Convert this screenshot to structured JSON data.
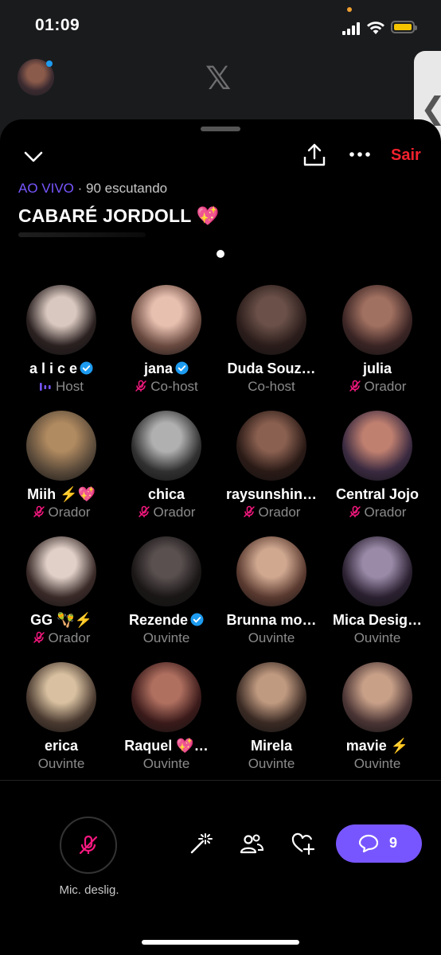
{
  "status_bar": {
    "time": "01:09"
  },
  "background_app": {
    "logo": "𝕏"
  },
  "header": {
    "leave_label": "Sair",
    "live_label": "AO VIVO",
    "listeners": "· 90 escutando",
    "title": "CABARÉ JORDOLL",
    "title_emoji": "💖"
  },
  "participants": [
    {
      "name": "a l i c e",
      "role": "Host",
      "verified": true,
      "mic": "host",
      "avatar_colors": [
        "#d9c8bf",
        "#2a2020"
      ]
    },
    {
      "name": "jana",
      "role": "Co-host",
      "verified": true,
      "mic": "off",
      "avatar_colors": [
        "#e8c0b0",
        "#6a4a40"
      ]
    },
    {
      "name": "Duda Souz…",
      "role": "Co-host",
      "verified": false,
      "mic": "none",
      "avatar_colors": [
        "#6a5048",
        "#2a1c1a"
      ]
    },
    {
      "name": "julia",
      "role": "Orador",
      "verified": false,
      "mic": "off",
      "avatar_colors": [
        "#a07060",
        "#3a2424"
      ]
    },
    {
      "name": "Miih ⚡️💖",
      "role": "Orador",
      "verified": false,
      "mic": "off",
      "avatar_colors": [
        "#b08a60",
        "#5a4a3a"
      ]
    },
    {
      "name": "chica",
      "role": "Orador",
      "verified": false,
      "mic": "off",
      "avatar_colors": [
        "#b0b0b0",
        "#303030"
      ]
    },
    {
      "name": "raysunshin…",
      "role": "Orador",
      "verified": false,
      "mic": "off",
      "avatar_colors": [
        "#8a6050",
        "#2a1a16"
      ]
    },
    {
      "name": "Central Jojo",
      "role": "Orador",
      "verified": false,
      "mic": "off",
      "avatar_colors": [
        "#c08070",
        "#3a2a40"
      ]
    },
    {
      "name": "GG 🪇⚡️",
      "role": "Orador",
      "verified": false,
      "mic": "off",
      "avatar_colors": [
        "#e0d0c8",
        "#3a2a28"
      ]
    },
    {
      "name": "Rezende",
      "role": "Ouvinte",
      "verified": true,
      "mic": "none",
      "avatar_colors": [
        "#5a5050",
        "#1a1616"
      ]
    },
    {
      "name": "Brunna mo…",
      "role": "Ouvinte",
      "verified": false,
      "mic": "none",
      "avatar_colors": [
        "#d0a890",
        "#5a3a30"
      ]
    },
    {
      "name": "Mica Desig…",
      "role": "Ouvinte",
      "verified": false,
      "mic": "none",
      "avatar_colors": [
        "#9a8aa8",
        "#2a2030"
      ]
    },
    {
      "name": "erica",
      "role": "Ouvinte",
      "verified": false,
      "mic": "none",
      "avatar_colors": [
        "#d8c0a0",
        "#4a3a30"
      ]
    },
    {
      "name": "Raquel 💖…",
      "role": "Ouvinte",
      "verified": false,
      "mic": "none",
      "avatar_colors": [
        "#b07060",
        "#3a1a1a"
      ]
    },
    {
      "name": "Mirela",
      "role": "Ouvinte",
      "verified": false,
      "mic": "none",
      "avatar_colors": [
        "#c09a80",
        "#3a2a24"
      ]
    },
    {
      "name": "mavie ⚡️",
      "role": "Ouvinte",
      "verified": false,
      "mic": "none",
      "avatar_colors": [
        "#c8a088",
        "#4a3434"
      ]
    }
  ],
  "footer": {
    "mic_label": "Mic. deslig.",
    "chat_count": "9"
  },
  "colors": {
    "accent": "#7856ff",
    "leave": "#f4212e",
    "mic_off": "#f91880",
    "verified": "#1d9bf0"
  }
}
